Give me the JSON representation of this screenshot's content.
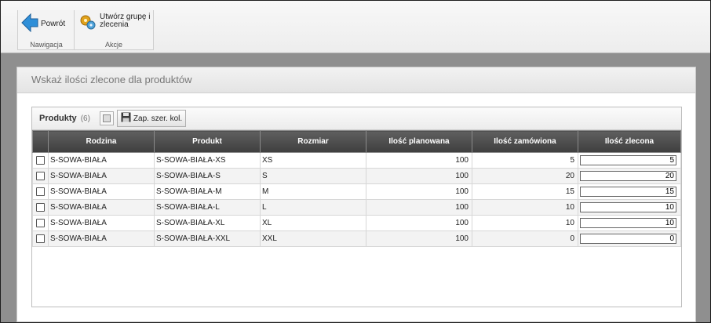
{
  "ribbon": {
    "groups": [
      {
        "label": "Nawigacja"
      },
      {
        "label": "Akcje"
      }
    ],
    "back_label": "Powrót",
    "create_label": "Utwórz grupę i zlecenia"
  },
  "panel": {
    "title": "Wskaż ilości zlecone dla produktów"
  },
  "grid": {
    "title": "Produkty",
    "count": "(6)",
    "save_columns_label": "Zap. szer. kol.",
    "columns": [
      "Rodzina",
      "Produkt",
      "Rozmiar",
      "Ilość planowana",
      "Ilość zamówiona",
      "Ilość zlecona"
    ],
    "rows": [
      {
        "family": "S-SOWA-BIAŁA",
        "product": "S-SOWA-BIAŁA-XS",
        "size": "XS",
        "planned": "100",
        "ordered": "5",
        "commissioned": "5"
      },
      {
        "family": "S-SOWA-BIAŁA",
        "product": "S-SOWA-BIAŁA-S",
        "size": "S",
        "planned": "100",
        "ordered": "20",
        "commissioned": "20"
      },
      {
        "family": "S-SOWA-BIAŁA",
        "product": "S-SOWA-BIAŁA-M",
        "size": "M",
        "planned": "100",
        "ordered": "15",
        "commissioned": "15"
      },
      {
        "family": "S-SOWA-BIAŁA",
        "product": "S-SOWA-BIAŁA-L",
        "size": "L",
        "planned": "100",
        "ordered": "10",
        "commissioned": "10"
      },
      {
        "family": "S-SOWA-BIAŁA",
        "product": "S-SOWA-BIAŁA-XL",
        "size": "XL",
        "planned": "100",
        "ordered": "10",
        "commissioned": "10"
      },
      {
        "family": "S-SOWA-BIAŁA",
        "product": "S-SOWA-BIAŁA-XXL",
        "size": "XXL",
        "planned": "100",
        "ordered": "0",
        "commissioned": "0"
      }
    ]
  },
  "icons": {
    "back": "arrow-left-icon",
    "create": "gears-icon",
    "columns": "columns-icon",
    "save": "floppy-disk-icon"
  },
  "colors": {
    "header_bg": "#4a4a4a",
    "back_arrow": "#2f8fd8",
    "gear": "#e0a21b"
  }
}
